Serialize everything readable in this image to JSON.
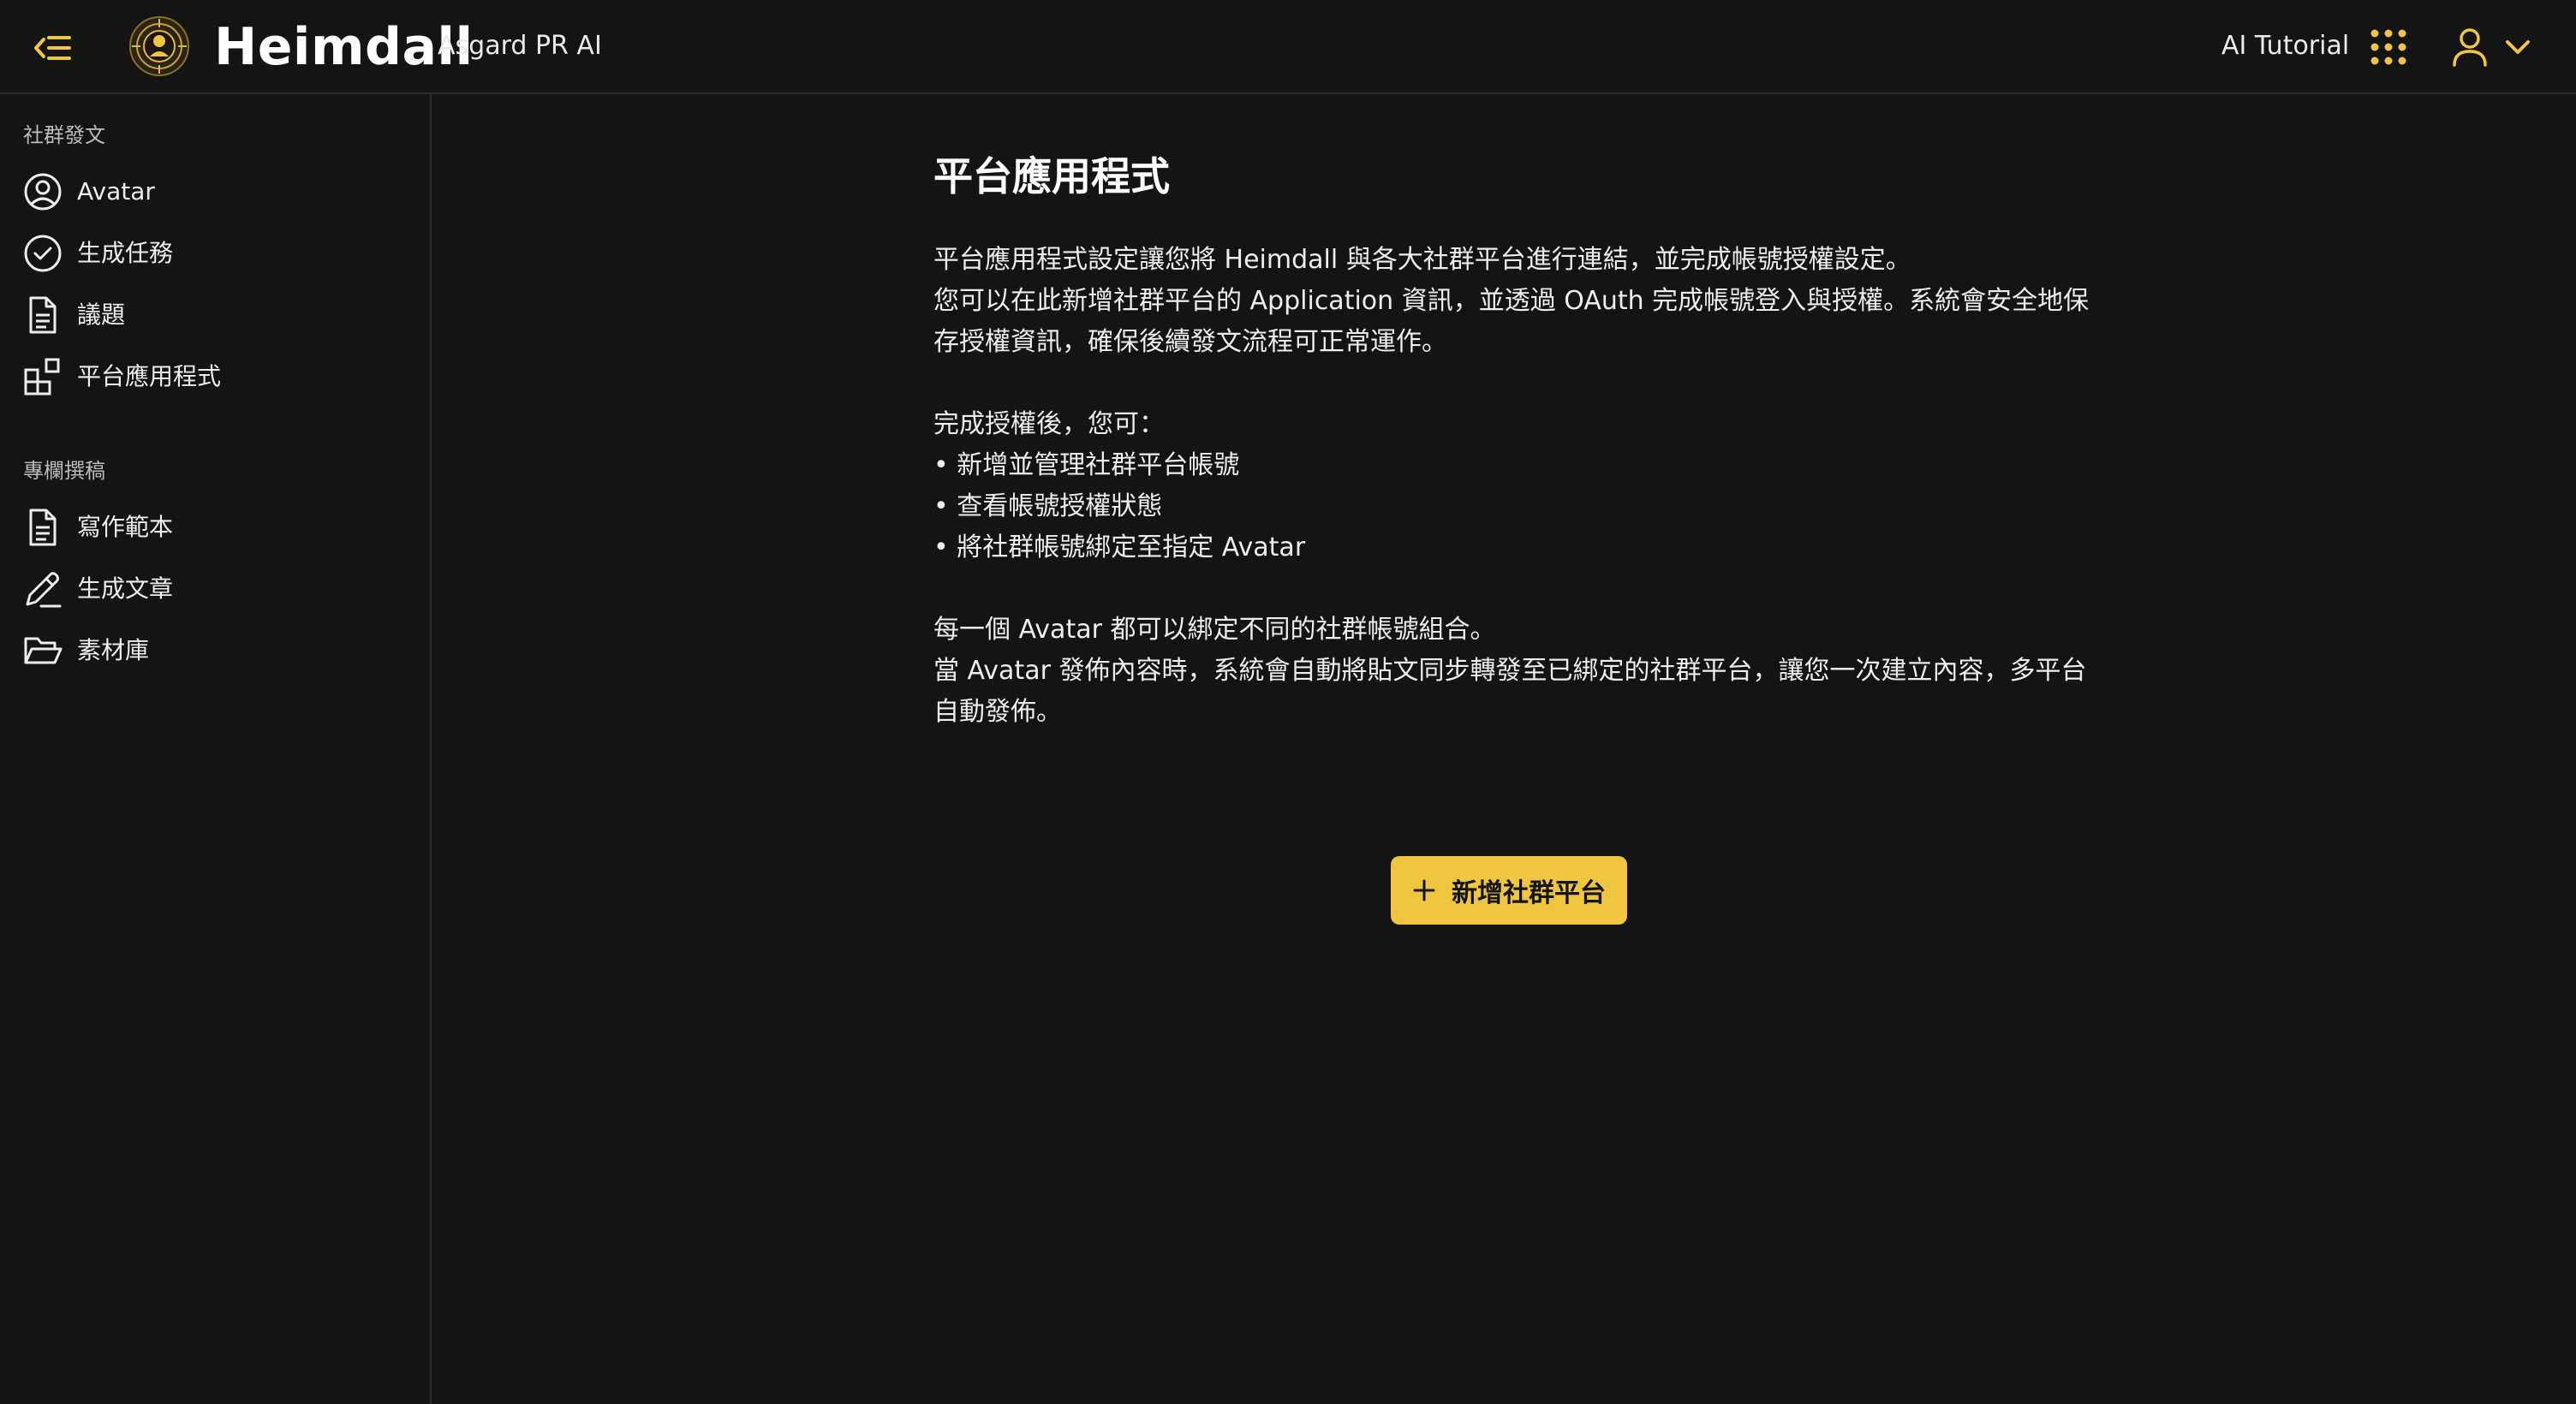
{
  "header": {
    "brand_title": "Heimdall",
    "brand_subtitle": "Asgard PR AI",
    "tutorial_label": "AI Tutorial",
    "collapse_icon": "collapse-sidebar-icon",
    "apps_icon": "grid-apps-icon",
    "user_icon": "user-icon",
    "user_chevron_icon": "chevron-down-icon"
  },
  "sidebar": {
    "sections": [
      {
        "title": "社群發文",
        "items": [
          {
            "label": "Avatar",
            "icon": "user-circle-icon"
          },
          {
            "label": "生成任務",
            "icon": "check-circle-icon"
          },
          {
            "label": "議題",
            "icon": "document-icon"
          },
          {
            "label": "平台應用程式",
            "icon": "apps-icon"
          }
        ]
      },
      {
        "title": "專欄撰稿",
        "items": [
          {
            "label": "寫作範本",
            "icon": "document-icon"
          },
          {
            "label": "生成文章",
            "icon": "pen-icon"
          },
          {
            "label": "素材庫",
            "icon": "folder-open-icon"
          }
        ]
      }
    ]
  },
  "main": {
    "title": "平台應用程式",
    "paragraph_lines": [
      "平台應用程式設定讓您將 Heimdall 與各大社群平台進行連結，並完成帳號授權設定。",
      "您可以在此新增社群平台的 Application 資訊，並透過 OAuth 完成帳號登入與授權。系統會安全地保",
      "存授權資訊，確保後續發文流程可正常運作。"
    ],
    "after_auth_heading": "完成授權後，您可：",
    "bullets": [
      "• 新增並管理社群平台帳號",
      "• 查看帳號授權狀態",
      "• 將社群帳號綁定至指定 Avatar"
    ],
    "closing_lines": [
      "每一個 Avatar 都可以綁定不同的社群帳號組合。",
      "當 Avatar 發佈內容時，系統會自動將貼文同步轉發至已綁定的社群平台，讓您一次建立內容，多平台",
      "自動發佈。"
    ],
    "add_button_label": "新增社群平台",
    "add_button_icon": "plus-icon"
  },
  "colors": {
    "background": "#141414",
    "accent": "#f0c53f",
    "border": "#2b2b2b"
  }
}
